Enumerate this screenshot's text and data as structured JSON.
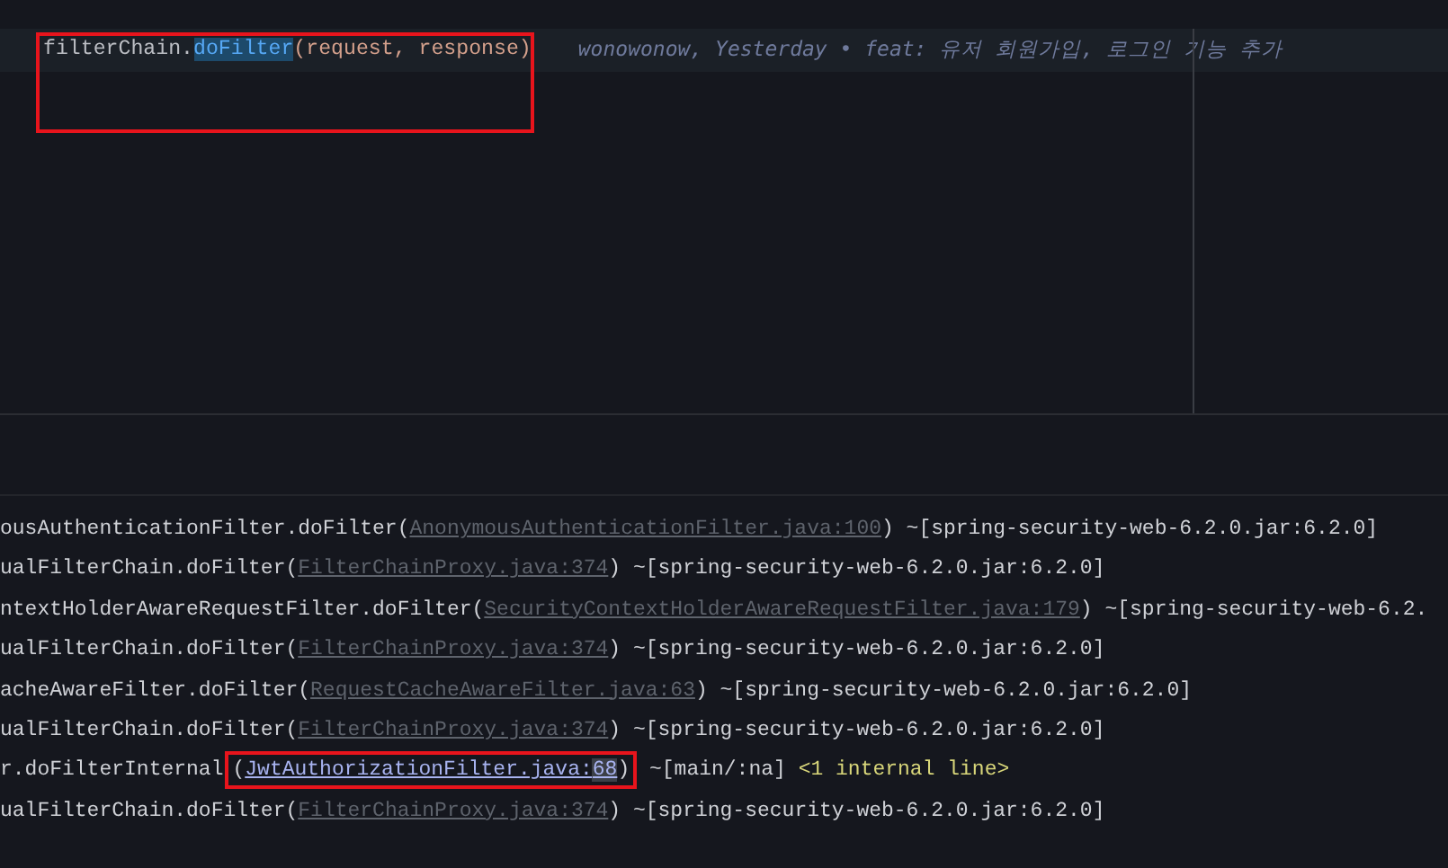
{
  "editor": {
    "code_line": {
      "receiver": "filterChain",
      "dot": ".",
      "method": "doFilter",
      "method_selected": true,
      "args": "(request, response)",
      "marked": true
    },
    "blame": "wonowonow, Yesterday • feat: 유저 회원가입, 로그인 기능 추가"
  },
  "console": {
    "lines": [
      {
        "prefix": "ousAuthenticationFilter.doFilter(",
        "link": "AnonymousAuthenticationFilter.java:100",
        "kind": "library",
        "suffix": ") ~[spring-security-web-6.2.0.jar:6.2.0]",
        "marked": false
      },
      {
        "prefix": "ualFilterChain.doFilter(",
        "link": "FilterChainProxy.java:374",
        "kind": "library",
        "suffix": ") ~[spring-security-web-6.2.0.jar:6.2.0]",
        "marked": false
      },
      {
        "prefix": "ntextHolderAwareRequestFilter.doFilter(",
        "link": "SecurityContextHolderAwareRequestFilter.java:179",
        "kind": "library",
        "suffix": ") ~[spring-security-web-6.2.",
        "marked": false
      },
      {
        "prefix": "ualFilterChain.doFilter(",
        "link": "FilterChainProxy.java:374",
        "kind": "library",
        "suffix": ") ~[spring-security-web-6.2.0.jar:6.2.0]",
        "marked": false
      },
      {
        "prefix": "acheAwareFilter.doFilter(",
        "link": "RequestCacheAwareFilter.java:63",
        "kind": "library",
        "suffix": ") ~[spring-security-web-6.2.0.jar:6.2.0]",
        "marked": false
      },
      {
        "prefix": "ualFilterChain.doFilter(",
        "link": "FilterChainProxy.java:374",
        "kind": "library",
        "suffix": ") ~[spring-security-web-6.2.0.jar:6.2.0]",
        "marked": false
      },
      {
        "prefix": "r.doFilterInternal",
        "open": "(",
        "link": "JwtAuthorizationFilter.java:",
        "link_highlight": "68",
        "kind": "project",
        "close": ")",
        "suffix": " ~[main/:na] ",
        "note": "<1 internal line>",
        "marked": true
      },
      {
        "prefix": "ualFilterChain.doFilter(",
        "link": "FilterChainProxy.java:374",
        "kind": "library",
        "suffix": ") ~[spring-security-web-6.2.0.jar:6.2.0]",
        "marked": false
      }
    ]
  }
}
